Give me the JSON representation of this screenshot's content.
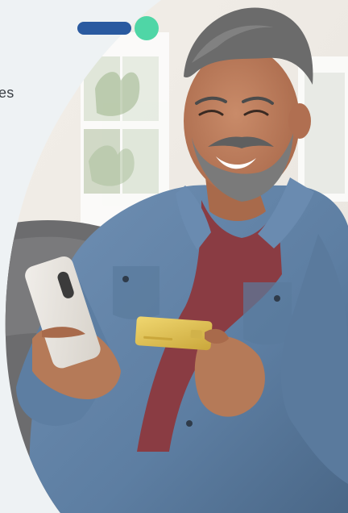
{
  "left_text": "es",
  "pager": {
    "active_color": "#2a5aa0",
    "inactive_color": "#4fd6a6"
  },
  "colors": {
    "background": "#eef2f4",
    "shirt": "#5f7fa1",
    "shirt_dark": "#4d6a89",
    "undershirt": "#8a3c43",
    "skin": "#b57a58",
    "hair": "#6b6b6b",
    "beard": "#7a7a7a",
    "phone": "#e6e2dc",
    "card": "#e3c55a",
    "wall": "#f6f4f1",
    "window": "#ffffff",
    "sofa": "#6c6c6e",
    "plant": "#9db58b"
  }
}
